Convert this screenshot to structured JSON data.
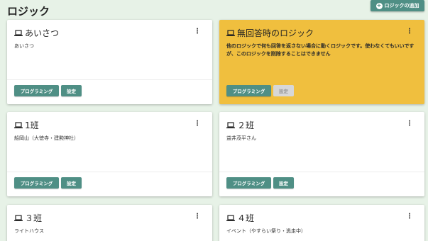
{
  "header": {
    "title": "ロジック",
    "add_button_label": "ロジックの追加",
    "add_icon": "plus-circle-icon"
  },
  "colors": {
    "background": "#e7f2e7",
    "accent": "#4f8f85",
    "warn_card": "#f0bf3e",
    "disabled": "#d7d7d7"
  },
  "buttons": {
    "programming_label": "プログラミング",
    "settings_label": "設定"
  },
  "cards": [
    {
      "title": "あいさつ",
      "description": "あいさつ",
      "icon": "laptop-icon",
      "menu": "⋮"
    },
    {
      "title": "無回答時のロジック",
      "description": "他のロジックで何も回答を返さない場合に動くロジックです。使わなくてもいいですが、このロジックを削除することはできません",
      "icon": "laptop-icon",
      "menu": "⋮",
      "settings_disabled": true
    },
    {
      "title": "1班",
      "description": "船岡山（大徳寺・建勲神社）",
      "icon": "laptop-icon",
      "menu": "⋮"
    },
    {
      "title": "２班",
      "description": "益井茂平さん",
      "icon": "laptop-icon",
      "menu": "⋮"
    },
    {
      "title": "３班",
      "description": "ライトハウス",
      "icon": "laptop-icon",
      "menu": "⋮"
    },
    {
      "title": "４班",
      "description": "イベント（やすらい祭り・逃走中）",
      "icon": "laptop-icon",
      "menu": "⋮"
    }
  ]
}
